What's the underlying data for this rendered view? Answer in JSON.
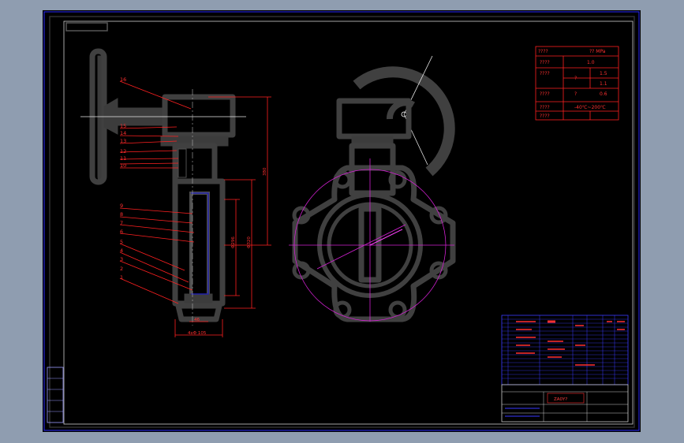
{
  "drawing": {
    "tech_table": {
      "rows": [
        {
          "label": "????",
          "value": "??  MPa"
        },
        {
          "label": "????",
          "value": "1.0"
        },
        {
          "label": "????",
          "sub": "?",
          "values": [
            "1.5",
            "1.1"
          ]
        },
        {
          "label": "????",
          "sub": "?",
          "value": "0.6"
        },
        {
          "label": "????",
          "value": "-40℃~200℃"
        },
        {
          "label": "????",
          "value": ""
        }
      ]
    },
    "part_numbers": [
      "16",
      "15",
      "14",
      "13",
      "12",
      "11",
      "10",
      "9",
      "8",
      "7",
      "6",
      "5",
      "4",
      "3",
      "2",
      "1"
    ],
    "dimensions": {
      "height": "380",
      "dia_a": "Φ296",
      "dia_b": "Φ320",
      "width_a": "46",
      "width_b": "4xΦ 105"
    },
    "title_block": {
      "drawing_name": "ZA0Y?"
    },
    "colors": {
      "sheet": "#000000",
      "outline": "#404040",
      "annotation": "#ff2020",
      "centerline": "#d020d0",
      "frame": "#2a2aff"
    }
  }
}
